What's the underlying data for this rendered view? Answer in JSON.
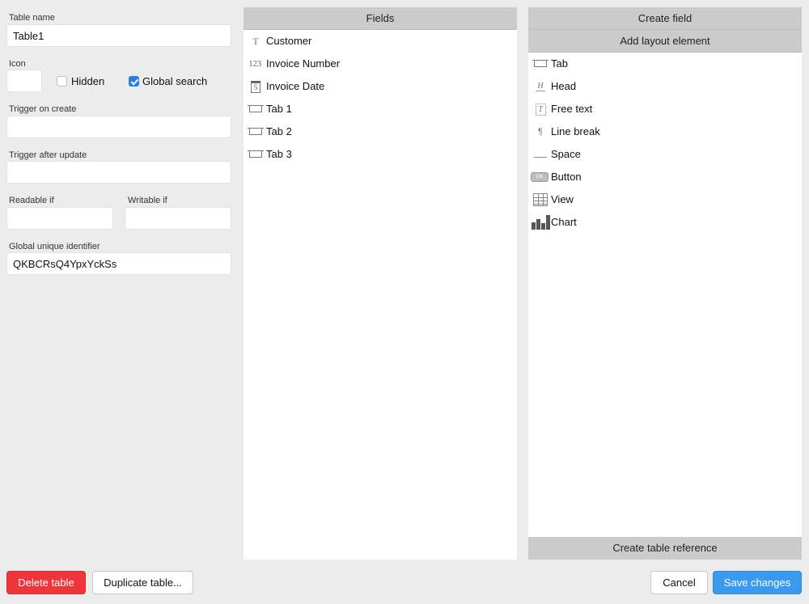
{
  "form": {
    "table_name_label": "Table name",
    "table_name_value": "Table1",
    "icon_label": "Icon",
    "hidden_label": "Hidden",
    "hidden_checked": false,
    "global_search_label": "Global search",
    "global_search_checked": true,
    "trigger_create_label": "Trigger on create",
    "trigger_create_value": "",
    "trigger_update_label": "Trigger after update",
    "trigger_update_value": "",
    "readable_label": "Readable if",
    "readable_value": "",
    "writable_label": "Writable if",
    "writable_value": "",
    "guid_label": "Global unique identifier",
    "guid_value": "QKBCRsQ4YpxYckSs"
  },
  "fields_panel": {
    "title": "Fields",
    "items": [
      {
        "icon": "text-icon",
        "label": "Customer"
      },
      {
        "icon": "number-icon",
        "label": "Invoice Number"
      },
      {
        "icon": "calendar-icon",
        "label": "Invoice Date"
      },
      {
        "icon": "tab-icon",
        "label": "Tab 1"
      },
      {
        "icon": "tab-icon",
        "label": "Tab 2"
      },
      {
        "icon": "tab-icon",
        "label": "Tab 3"
      }
    ]
  },
  "create_panel": {
    "create_field_label": "Create field",
    "add_layout_label": "Add layout element",
    "items": [
      {
        "icon": "tab-icon",
        "label": "Tab"
      },
      {
        "icon": "heading-icon",
        "label": "Head"
      },
      {
        "icon": "free-text-icon",
        "label": "Free text"
      },
      {
        "icon": "pilcrow-icon",
        "label": "Line break"
      },
      {
        "icon": "space-icon",
        "label": "Space"
      },
      {
        "icon": "button-icon",
        "label": "Button"
      },
      {
        "icon": "table-view-icon",
        "label": "View"
      },
      {
        "icon": "bar-chart-icon",
        "label": "Chart"
      }
    ],
    "create_reference_label": "Create table reference"
  },
  "footer": {
    "delete_label": "Delete table",
    "duplicate_label": "Duplicate table...",
    "cancel_label": "Cancel",
    "save_label": "Save changes"
  },
  "colors": {
    "accent": "#3a9af0",
    "danger": "#f0343c",
    "panel_header": "#cbcbcb",
    "background": "#ececec"
  }
}
